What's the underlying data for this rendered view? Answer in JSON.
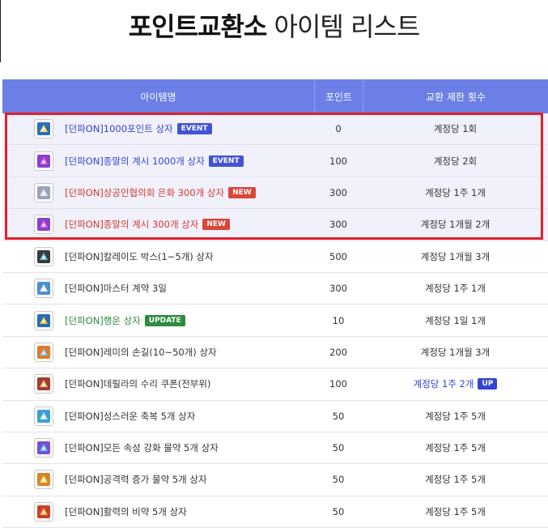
{
  "page": {
    "title_bold": "포인트교환소",
    "title_thin": "아이템 리스트"
  },
  "table": {
    "headers": [
      "아이템명",
      "포인트",
      "교환 제한 횟수"
    ],
    "rows": [
      {
        "name": "[던파ON]1000포인트 상자",
        "badge": "EVENT",
        "badge_kind": "event",
        "name_color": "blue",
        "points": "0",
        "limit": "계정당 1회",
        "limit_badge": "",
        "icon": "gift-box-icon",
        "hl": true
      },
      {
        "name": "[던파ON]종말의 계시 1000개 상자",
        "badge": "EVENT",
        "badge_kind": "event",
        "name_color": "blue",
        "points": "100",
        "limit": "계정당 2회",
        "limit_badge": "",
        "icon": "purple-box-icon",
        "hl": true
      },
      {
        "name": "[던파ON]상공인협의회 은화 300개 상자",
        "badge": "NEW",
        "badge_kind": "new",
        "name_color": "red",
        "points": "300",
        "limit": "계정당 1주 1개",
        "limit_badge": "",
        "icon": "silver-coin-icon",
        "hl": true
      },
      {
        "name": "[던파ON]종말의 계시 300개 상자",
        "badge": "NEW",
        "badge_kind": "new",
        "name_color": "red",
        "points": "300",
        "limit": "계정당 1개월 2개",
        "limit_badge": "",
        "icon": "purple-box-icon",
        "hl": true
      },
      {
        "name": "[던파ON]칼레이도 박스(1~5개) 상자",
        "badge": "",
        "badge_kind": "",
        "name_color": "",
        "points": "500",
        "limit": "계정당 1개월 3개",
        "limit_badge": "",
        "icon": "kaleido-box-icon",
        "hl": false
      },
      {
        "name": "[던파ON]마스터 계약 3일",
        "badge": "",
        "badge_kind": "",
        "name_color": "",
        "points": "300",
        "limit": "계정당 1주 1개",
        "limit_badge": "",
        "icon": "contract-icon",
        "hl": false
      },
      {
        "name": "[던파ON]행운 상자",
        "badge": "UPDATE",
        "badge_kind": "update",
        "name_color": "green",
        "points": "10",
        "limit": "계정당 1일 1개",
        "limit_badge": "",
        "icon": "lucky-box-icon",
        "hl": false
      },
      {
        "name": "[던파ON]레미의 손길(10~50개) 상자",
        "badge": "",
        "badge_kind": "",
        "name_color": "",
        "points": "200",
        "limit": "계정당 1개월 3개",
        "limit_badge": "",
        "icon": "remy-touch-icon",
        "hl": false
      },
      {
        "name": "[던파ON]데릴라의 수리 쿠폰(전부위)",
        "badge": "",
        "badge_kind": "",
        "name_color": "",
        "points": "100",
        "limit": "계정당 1주 2개",
        "limit_badge": "UP",
        "icon": "repair-coupon-icon",
        "hl": false
      },
      {
        "name": "[던파ON]성스러운 축복 5개 상자",
        "badge": "",
        "badge_kind": "",
        "name_color": "",
        "points": "50",
        "limit": "계정당 1주 5개",
        "limit_badge": "",
        "icon": "blessing-box-icon",
        "hl": false
      },
      {
        "name": "[던파ON]모든 속성 강화 물약 5개 상자",
        "badge": "",
        "badge_kind": "",
        "name_color": "",
        "points": "50",
        "limit": "계정당 1주 5개",
        "limit_badge": "",
        "icon": "element-potion-icon",
        "hl": false
      },
      {
        "name": "[던파ON]공격력 증가 물약 5개 상자",
        "badge": "",
        "badge_kind": "",
        "name_color": "",
        "points": "50",
        "limit": "계정당 1주 5개",
        "limit_badge": "",
        "icon": "attack-potion-icon",
        "hl": false
      },
      {
        "name": "[던파ON]활력의 비약 5개 상자",
        "badge": "",
        "badge_kind": "",
        "name_color": "",
        "points": "50",
        "limit": "계정당 1주 5개",
        "limit_badge": "",
        "icon": "vitality-elixir-icon",
        "hl": false
      }
    ]
  },
  "colors": {
    "header_bg": "#6b7fe6",
    "highlight_border": "#e0202a",
    "event": "#4453d6",
    "new": "#d9473a",
    "update": "#2e8b3f"
  }
}
